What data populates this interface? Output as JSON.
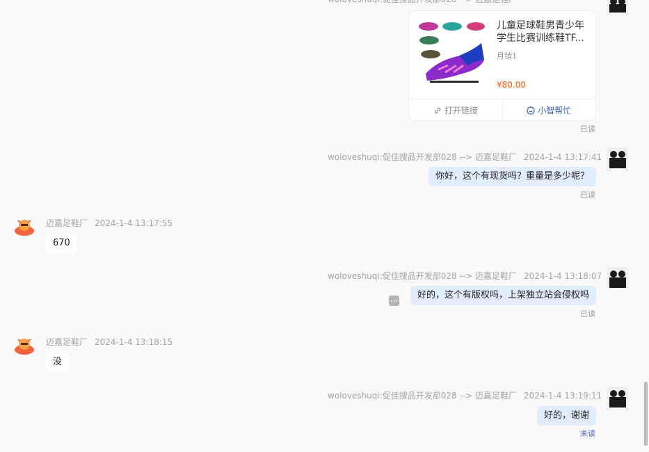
{
  "sender_mine": "woloveshuqi:促佳搜品开发部028 --> 迈嘉足鞋厂",
  "sender_other": "迈嘉足鞋厂",
  "product_card": {
    "title": "儿童足球鞋男青少年学生比赛训练鞋TF...",
    "monthly_sales": "月销1",
    "price": "¥80.00",
    "open_link_label": "打开链接",
    "assistant_label": "小智帮忙",
    "status": "已读"
  },
  "messages": [
    {
      "id": "m1",
      "time": "2024-1-4 13:17:41",
      "text": "你好，这个有现货吗？重量是多少呢？",
      "status": "已读"
    },
    {
      "id": "m2",
      "time": "2024-1-4 13:17:55",
      "text": "670"
    },
    {
      "id": "m3",
      "time": "2024-1-4 13:18:07",
      "text": "好的，这个有版权吗，上架独立站会侵权吗",
      "status": "已读"
    },
    {
      "id": "m4",
      "time": "2024-1-4 13:18:15",
      "text": "没"
    },
    {
      "id": "m5",
      "time": "2024-1-4 13:19:11",
      "text": "好的，谢谢",
      "status": "未读"
    }
  ],
  "colors": {
    "background": "#f9f9fa",
    "bubble_mine": "#e1edfd",
    "price": "#ff5a00",
    "unread": "#3f62c8"
  }
}
